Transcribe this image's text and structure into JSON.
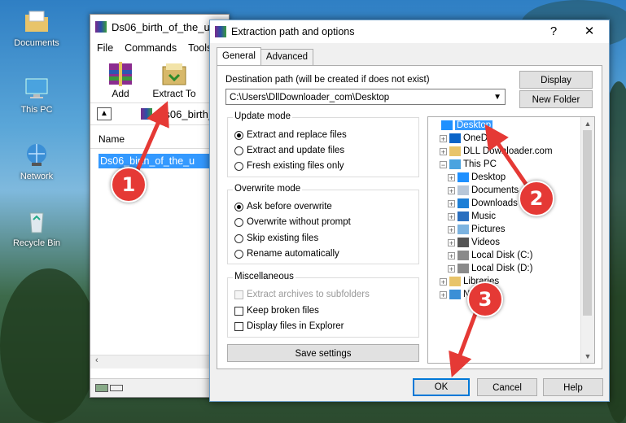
{
  "desktop": {
    "icons": [
      {
        "label": "Documents",
        "icon": "documents-folder-icon"
      },
      {
        "label": "This PC",
        "icon": "this-pc-icon"
      },
      {
        "label": "Network",
        "icon": "network-icon"
      },
      {
        "label": "Recycle Bin",
        "icon": "recycle-bin-icon"
      }
    ]
  },
  "winrar": {
    "title": "Ds06_birth_of_the_u",
    "menu": [
      "File",
      "Commands",
      "Tools"
    ],
    "toolbar": {
      "add": "Add",
      "extract_to": "Extract To"
    },
    "address": "Ds06_birth_",
    "column_name": "Name",
    "file_row": "Ds06_birth_of_the_u"
  },
  "dialog": {
    "title": "Extraction path and options",
    "help_glyph": "?",
    "close_glyph": "✕",
    "tabs": [
      "General",
      "Advanced"
    ],
    "destination_label": "Destination path (will be created if does not exist)",
    "destination_value": "C:\\Users\\DllDownloader_com\\Desktop",
    "display_button": "Display",
    "new_folder_button": "New Folder",
    "update_mode": {
      "title": "Update mode",
      "options": [
        "Extract and replace files",
        "Extract and update files",
        "Fresh existing files only"
      ],
      "selected": 0
    },
    "overwrite_mode": {
      "title": "Overwrite mode",
      "options": [
        "Ask before overwrite",
        "Overwrite without prompt",
        "Skip existing files",
        "Rename automatically"
      ],
      "selected": 0
    },
    "miscellaneous": {
      "title": "Miscellaneous",
      "options": [
        {
          "label": "Extract archives to subfolders",
          "checked": false,
          "disabled": true
        },
        {
          "label": "Keep broken files",
          "checked": false,
          "disabled": false
        },
        {
          "label": "Display files in Explorer",
          "checked": false,
          "disabled": false
        }
      ]
    },
    "save_settings_button": "Save settings",
    "tree": [
      {
        "label": "Desktop",
        "icon": "desktop-folder-icon",
        "level": 0,
        "selected": true,
        "expander": ""
      },
      {
        "label": "OneDrive",
        "icon": "onedrive-icon",
        "level": 1,
        "selected": false,
        "expander": "+"
      },
      {
        "label": "DLL Downloader.com",
        "icon": "user-folder-icon",
        "level": 1,
        "selected": false,
        "expander": "+"
      },
      {
        "label": "This PC",
        "icon": "this-pc-icon",
        "level": 1,
        "selected": false,
        "expander": "−"
      },
      {
        "label": "Desktop",
        "icon": "desktop-folder-icon",
        "level": 2,
        "selected": false,
        "expander": "+"
      },
      {
        "label": "Documents",
        "icon": "documents-folder-icon",
        "level": 2,
        "selected": false,
        "expander": "+"
      },
      {
        "label": "Downloads",
        "icon": "downloads-folder-icon",
        "level": 2,
        "selected": false,
        "expander": "+"
      },
      {
        "label": "Music",
        "icon": "music-folder-icon",
        "level": 2,
        "selected": false,
        "expander": "+"
      },
      {
        "label": "Pictures",
        "icon": "pictures-folder-icon",
        "level": 2,
        "selected": false,
        "expander": "+"
      },
      {
        "label": "Videos",
        "icon": "videos-folder-icon",
        "level": 2,
        "selected": false,
        "expander": "+"
      },
      {
        "label": "Local Disk (C:)",
        "icon": "local-disk-icon",
        "level": 2,
        "selected": false,
        "expander": "+"
      },
      {
        "label": "Local Disk (D:)",
        "icon": "local-disk-icon",
        "level": 2,
        "selected": false,
        "expander": "+"
      },
      {
        "label": "Libraries",
        "icon": "libraries-folder-icon",
        "level": 1,
        "selected": false,
        "expander": "+"
      },
      {
        "label": "Network",
        "icon": "network-icon",
        "level": 1,
        "selected": false,
        "expander": "+"
      }
    ],
    "ok_button": "OK",
    "cancel_button": "Cancel",
    "help_button": "Help"
  },
  "callouts": [
    "1",
    "2",
    "3"
  ],
  "colors": {
    "accent": "#0078d7",
    "callout": "#e53935",
    "selection": "#3399ff"
  }
}
